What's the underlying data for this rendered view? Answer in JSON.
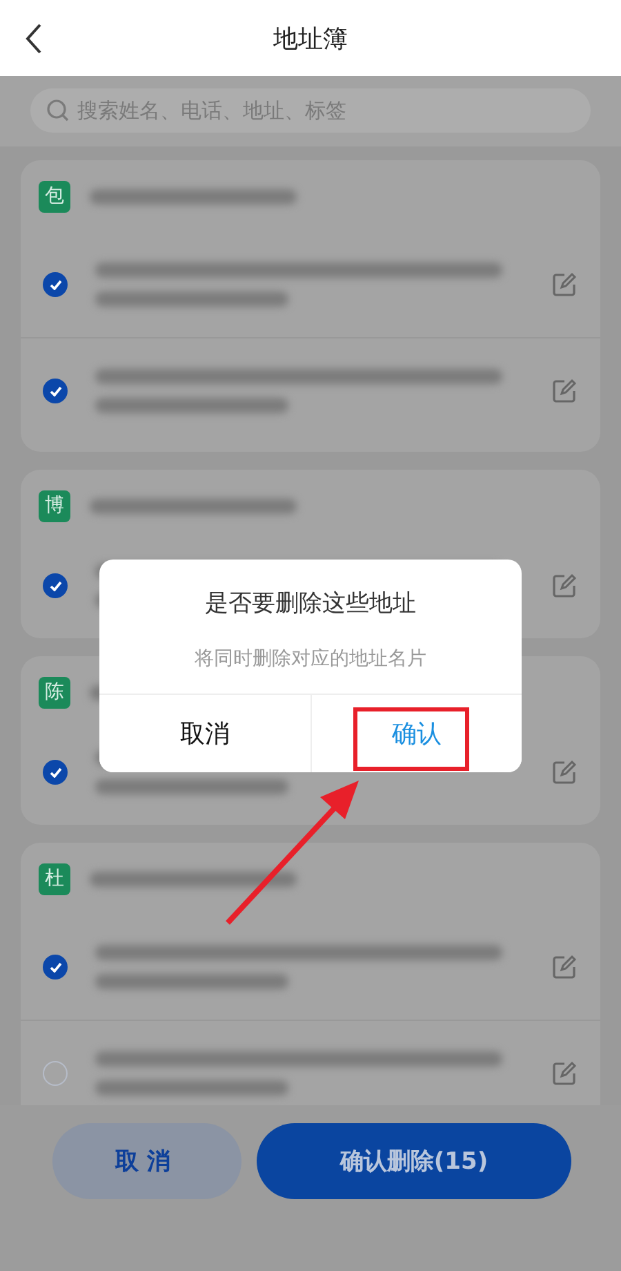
{
  "header": {
    "title": "地址簿"
  },
  "search": {
    "placeholder": "搜索姓名、电话、地址、标签"
  },
  "groups": [
    {
      "letter": "包",
      "entries": [
        {
          "checked": true
        },
        {
          "checked": true
        }
      ]
    },
    {
      "letter": "博",
      "entries": [
        {
          "checked": true
        }
      ]
    },
    {
      "letter": "陈",
      "entries": [
        {
          "checked": true
        }
      ]
    },
    {
      "letter": "杜",
      "entries": [
        {
          "checked": true
        },
        {
          "checked": false
        }
      ]
    }
  ],
  "dialog": {
    "title": "是否要删除这些地址",
    "message": "将同时删除对应的地址名片",
    "buttons": [
      {
        "label": "取消",
        "kind": "cancel"
      },
      {
        "label": "确认",
        "kind": "confirm"
      }
    ]
  },
  "bottom_bar": {
    "buttons": [
      {
        "label": "取消",
        "kind": "cancel"
      },
      {
        "label": "确认删除(15)",
        "kind": "confirm"
      }
    ]
  },
  "annotations": [
    {
      "kind": "highlight-box"
    },
    {
      "kind": "arrow"
    }
  ]
}
